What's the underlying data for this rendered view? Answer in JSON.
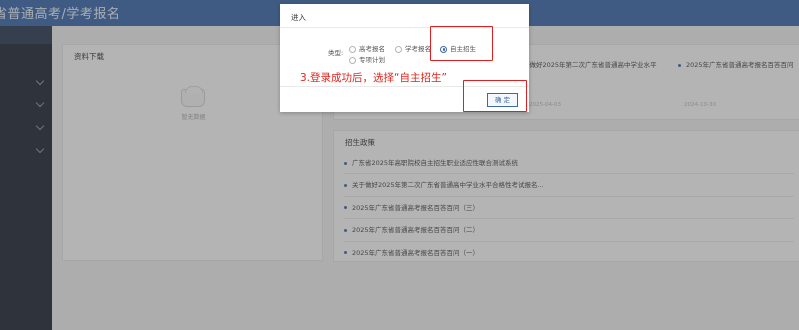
{
  "header": {
    "title": "省普通高考/学考报名"
  },
  "sidebar": {
    "chevrons": [
      "chevron-down-icon",
      "chevron-down-icon",
      "chevron-down-icon",
      "chevron-down-icon"
    ]
  },
  "download": {
    "title": "资料下载",
    "empty_text": "暂无数据"
  },
  "notices": {
    "items": [
      {
        "text": "于做好2025年第二次广东省普通高中学业水平"
      },
      {
        "text": "2025年广东省普通高考报名百答百问"
      }
    ],
    "dates": [
      "2025-04-03",
      "2024-10-30"
    ]
  },
  "policy": {
    "title": "招生政策",
    "items": [
      "广东省2025年高职院校自主招生职业适应性联合测试系统",
      "关于做好2025年第二次广东省普通高中学业水平合格性考试报名...",
      "2025年广东省普通高考报名百答百问（三）",
      "2025年广东省普通高考报名百答百问（二）",
      "2025年广东省普通高考报名百答百问（一）"
    ]
  },
  "modal": {
    "title": "进入",
    "type_label": "类型:",
    "options": [
      {
        "label": "高考报名",
        "checked": false
      },
      {
        "label": "学考报名",
        "checked": false
      },
      {
        "label": "自主招生",
        "checked": true
      },
      {
        "label": "专项计划",
        "checked": false
      }
    ],
    "ok_label": "确 定"
  },
  "annotation": {
    "hint": "3.登录成功后，选择“自主招生”",
    "color": "#e02020"
  },
  "colors": {
    "brand": "#3c68a8",
    "sidebar": "#1f2836"
  }
}
